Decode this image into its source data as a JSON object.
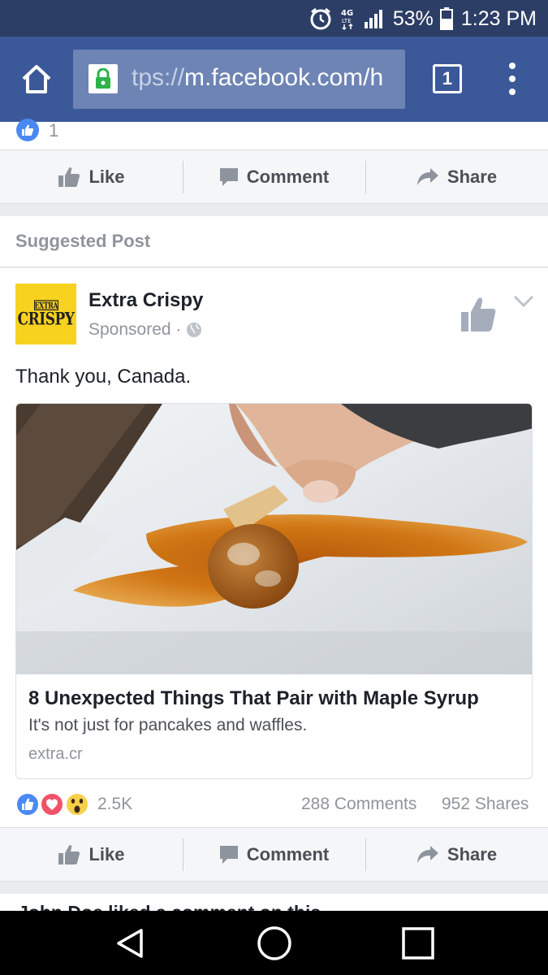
{
  "status_bar": {
    "network": "4G LTE",
    "battery": "53%",
    "time": "1:23 PM"
  },
  "browser": {
    "url_dim": "tps://",
    "url_main": "m.facebook.com/",
    "url_tail": "h",
    "tab_count": "1"
  },
  "previous_post": {
    "like_count": "1",
    "actions": {
      "like": "Like",
      "comment": "Comment",
      "share": "Share"
    }
  },
  "suggested_header": "Suggested Post",
  "post": {
    "page_name": "Extra Crispy",
    "sponsored": "Sponsored ·",
    "text": "Thank you, Canada.",
    "avatar_logo_top": "EXTRA",
    "avatar_logo_main": "CRISPY",
    "link": {
      "title": "8 Unexpected Things That Pair with Maple Syrup",
      "description": "It's not just for pancakes and waffles.",
      "domain": "extra.cr"
    },
    "reaction_count": "2.5K",
    "comments": "288 Comments",
    "shares": "952 Shares",
    "actions": {
      "like": "Like",
      "comment": "Comment",
      "share": "Share"
    }
  },
  "next_post_peek": "John Doe liked a comment on this",
  "colors": {
    "facebook_blue": "#3b5998",
    "status_bar": "#2c3e66",
    "avatar_yellow": "#f7d21f",
    "like_blue": "#4a89f3",
    "love_red": "#f25268",
    "wow_yellow": "#f7d04a"
  }
}
